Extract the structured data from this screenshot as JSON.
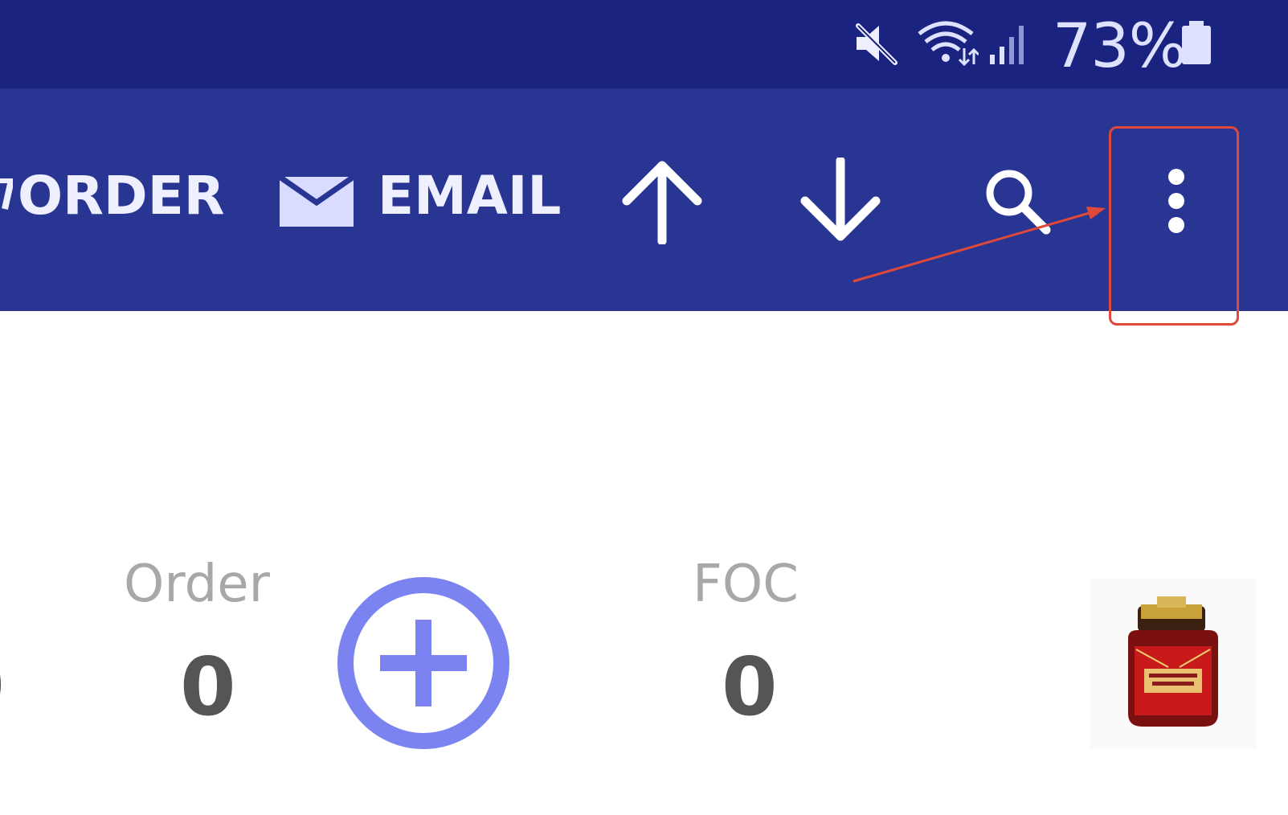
{
  "status_bar": {
    "battery_percent": "73%",
    "icons": [
      "mute-icon",
      "wifi-icon",
      "signal-icon",
      "battery-icon"
    ]
  },
  "toolbar": {
    "order_label": "ORDER",
    "email_label": "EMAIL",
    "actions": [
      "arrow-up-icon",
      "arrow-down-icon",
      "search-icon",
      "more-vert-icon"
    ]
  },
  "order": {
    "label": "Order",
    "value": "0"
  },
  "foc": {
    "label": "FOC",
    "value": "0"
  },
  "colors": {
    "status_bar": "#1b2380",
    "toolbar": "#283593",
    "accent": "#7b83f0",
    "annotation": "#e0483a"
  }
}
